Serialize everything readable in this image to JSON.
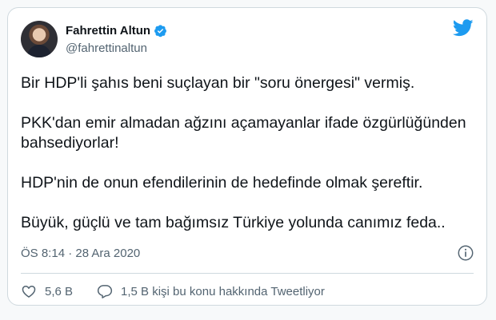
{
  "author": {
    "display_name": "Fahrettin Altun",
    "handle": "@fahrettinaltun",
    "verified": true
  },
  "tweet": {
    "paragraphs": [
      "Bir HDP'li şahıs beni suçlayan bir \"soru önergesi\" vermiş.",
      "PKK'dan emir almadan ağzını açamayanlar ifade özgürlüğünden bahsediyorlar!",
      "HDP'nin de onun efendilerinin de hedefinde olmak şereftir.",
      "Büyük, güçlü ve tam bağımsız Türkiye yolunda canımız feda.."
    ],
    "timestamp": "ÖS 8:14 · 28 Ara 2020"
  },
  "actions": {
    "likes": "5,6 B",
    "discussion": "1,5 B kişi bu konu hakkında Tweetliyor"
  },
  "icons": {
    "brand": "twitter-bird-icon",
    "verified": "verified-badge-icon",
    "info": "info-icon",
    "like": "heart-icon",
    "discussion": "speech-bubble-icon"
  },
  "colors": {
    "brand": "#1d9bf0",
    "text": "#0f1419",
    "muted": "#536471",
    "border": "#cfd9de"
  }
}
